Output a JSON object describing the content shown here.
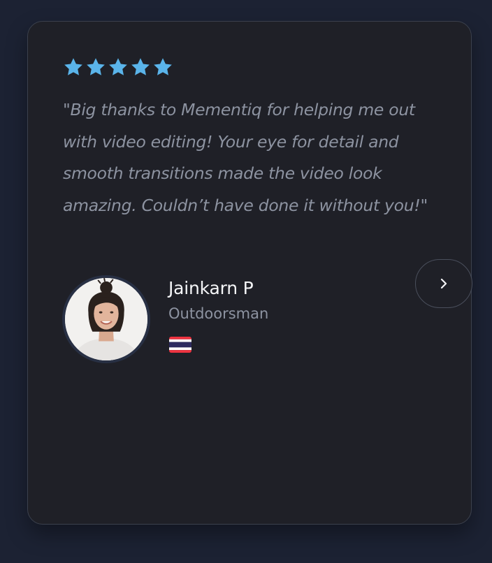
{
  "testimonial": {
    "rating": 5,
    "rating_max": 5,
    "quote": "\"Big thanks to Mementiq for helping me out with video editing! Your eye for detail and smooth transitions made the video look amazing. Couldn’t have done it without you!\"",
    "author": {
      "name": "Jainkarn P",
      "title": "Outdoorsman",
      "flag_icon": "thailand-flag-icon"
    }
  },
  "controls": {
    "next_icon": "chevron-right-icon"
  },
  "colors": {
    "page_background": "#1c2233",
    "card_background": "#1f2027",
    "card_border": "#3b404d",
    "star": "#5ab4ea",
    "quote_text": "#8d93a1",
    "name_text": "#f4f5f7"
  }
}
